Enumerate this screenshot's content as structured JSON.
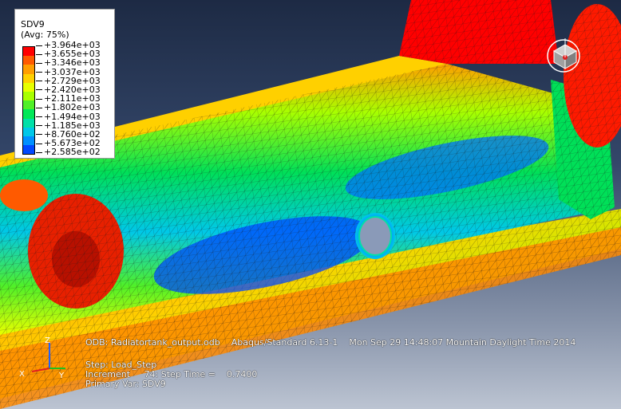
{
  "legend": {
    "title": "SDV9",
    "subtitle": "(Avg: 75%)",
    "labels": [
      "+3.964e+03",
      "+3.655e+03",
      "+3.346e+03",
      "+3.037e+03",
      "+2.729e+03",
      "+2.420e+03",
      "+2.111e+03",
      "+1.802e+03",
      "+1.494e+03",
      "+1.185e+03",
      "+8.760e+02",
      "+5.673e+02",
      "+2.585e+02"
    ],
    "colors": [
      "#ff0000",
      "#ff5a00",
      "#ff9e00",
      "#ffd000",
      "#e8ff00",
      "#a8ff00",
      "#50f028",
      "#00e858",
      "#00e0a8",
      "#00c8e8",
      "#0090ff",
      "#0048ff",
      "#0000e8"
    ]
  },
  "info": {
    "odb_line": "ODB: Radiatortank_output.odb    Abaqus/Standard 6.13-1    Mon Sep 29 14:48:07 Mountain Daylight Time 2014",
    "step_line": "Step: Load_Step",
    "increment_line": "Increment     74: Step Time =    0.7400",
    "primary_var_line": "Primary Var: SDV9"
  },
  "triad": {
    "x_label": "X",
    "y_label": "Y",
    "z_label": "Z"
  },
  "colors": {
    "triad_x": "#e02020",
    "triad_y": "#20c020",
    "triad_z": "#2060ff",
    "mesh": "#1a1a1a"
  },
  "icons": {
    "view_triad": "view-cube-icon",
    "axis_triad": "axis-triad-icon"
  }
}
